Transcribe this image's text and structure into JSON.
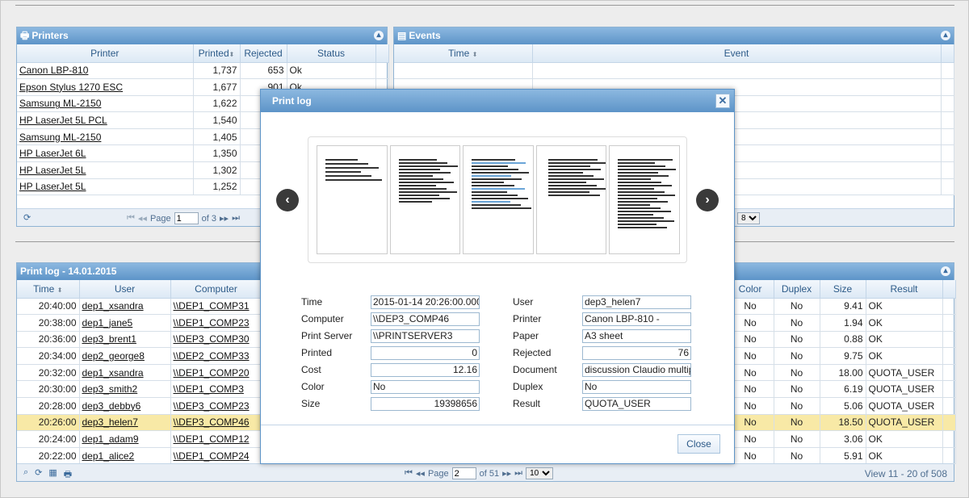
{
  "printers_panel": {
    "title": "Printers",
    "columns": [
      "Printer",
      "Printed",
      "Rejected",
      "Status"
    ],
    "rows": [
      {
        "printer": "Canon LBP-810",
        "printed": "1,737",
        "rejected": "653",
        "status": "Ok"
      },
      {
        "printer": "Epson Stylus 1270 ESC",
        "printed": "1,677",
        "rejected": "901",
        "status": "Ok"
      },
      {
        "printer": "Samsung ML-2150",
        "printed": "1,622",
        "rejected": "",
        "status": ""
      },
      {
        "printer": "HP LaserJet 5L PCL",
        "printed": "1,540",
        "rejected": "",
        "status": ""
      },
      {
        "printer": "Samsung ML-2150",
        "printed": "1,405",
        "rejected": "",
        "status": ""
      },
      {
        "printer": "HP LaserJet 6L",
        "printed": "1,350",
        "rejected": "",
        "status": ""
      },
      {
        "printer": "HP LaserJet 5L",
        "printed": "1,302",
        "rejected": "",
        "status": ""
      },
      {
        "printer": "HP LaserJet 5L",
        "printed": "1,252",
        "rejected": "",
        "status": ""
      }
    ],
    "pager": {
      "page_label": "Page",
      "page_value": "1",
      "of_label": "of 3"
    }
  },
  "events_panel": {
    "title": "Events",
    "columns": [
      "Time",
      "Event"
    ],
    "pager_select": "8"
  },
  "printlog_panel": {
    "title": "Print log - 14.01.2015",
    "columns": [
      "Time",
      "User",
      "Computer",
      "Color",
      "Duplex",
      "Size",
      "Result"
    ],
    "rows": [
      {
        "time": "20:40:00",
        "user": "dep1_xsandra",
        "computer": "\\\\DEP1_COMP31",
        "color": "No",
        "duplex": "No",
        "size": "9.41",
        "result": "OK"
      },
      {
        "time": "20:38:00",
        "user": "dep1_jane5",
        "computer": "\\\\DEP1_COMP23",
        "color": "No",
        "duplex": "No",
        "size": "1.94",
        "result": "OK"
      },
      {
        "time": "20:36:00",
        "user": "dep3_brent1",
        "computer": "\\\\DEP3_COMP30",
        "color": "No",
        "duplex": "No",
        "size": "0.88",
        "result": "OK"
      },
      {
        "time": "20:34:00",
        "user": "dep2_george8",
        "computer": "\\\\DEP2_COMP33",
        "color": "No",
        "duplex": "No",
        "size": "9.75",
        "result": "OK"
      },
      {
        "time": "20:32:00",
        "user": "dep1_xsandra",
        "computer": "\\\\DEP1_COMP20",
        "color": "No",
        "duplex": "No",
        "size": "18.00",
        "result": "QUOTA_USER"
      },
      {
        "time": "20:30:00",
        "user": "dep3_smith2",
        "computer": "\\\\DEP1_COMP3",
        "color": "No",
        "duplex": "No",
        "size": "6.19",
        "result": "QUOTA_USER"
      },
      {
        "time": "20:28:00",
        "user": "dep3_debby6",
        "computer": "\\\\DEP3_COMP23",
        "color": "No",
        "duplex": "No",
        "size": "5.06",
        "result": "QUOTA_USER"
      },
      {
        "time": "20:26:00",
        "user": "dep3_helen7",
        "computer": "\\\\DEP3_COMP46",
        "color": "No",
        "duplex": "No",
        "size": "18.50",
        "result": "QUOTA_USER",
        "selected": true
      },
      {
        "time": "20:24:00",
        "user": "dep1_adam9",
        "computer": "\\\\DEP1_COMP12",
        "color": "No",
        "duplex": "No",
        "size": "3.06",
        "result": "OK"
      },
      {
        "time": "20:22:00",
        "user": "dep1_alice2",
        "computer": "\\\\DEP1_COMP24",
        "color": "No",
        "duplex": "No",
        "size": "5.91",
        "result": "OK"
      }
    ],
    "pager": {
      "page_label": "Page",
      "page_value": "2",
      "of_label": "of 51",
      "page_size": "10",
      "view_info": "View 11 - 20 of 508"
    }
  },
  "dialog": {
    "title": "Print log",
    "close_label": "Close",
    "fields_left": [
      {
        "label": "Time",
        "value": "2015-01-14 20:26:00.000"
      },
      {
        "label": "Computer",
        "value": "\\\\DEP3_COMP46"
      },
      {
        "label": "Print Server",
        "value": "\\\\PRINTSERVER3"
      },
      {
        "label": "Printed",
        "value": "0"
      },
      {
        "label": "Cost",
        "value": "12.16"
      },
      {
        "label": "Color",
        "value": "No"
      },
      {
        "label": "Size",
        "value": "19398656"
      }
    ],
    "fields_right": [
      {
        "label": "User",
        "value": "dep3_helen7"
      },
      {
        "label": "Printer",
        "value": "Canon LBP-810 -"
      },
      {
        "label": "Paper",
        "value": "A3 sheet"
      },
      {
        "label": "Rejected",
        "value": "76"
      },
      {
        "label": "Document",
        "value": "discussion Claudio multipl"
      },
      {
        "label": "Duplex",
        "value": "No"
      },
      {
        "label": "Result",
        "value": "QUOTA_USER"
      }
    ]
  }
}
